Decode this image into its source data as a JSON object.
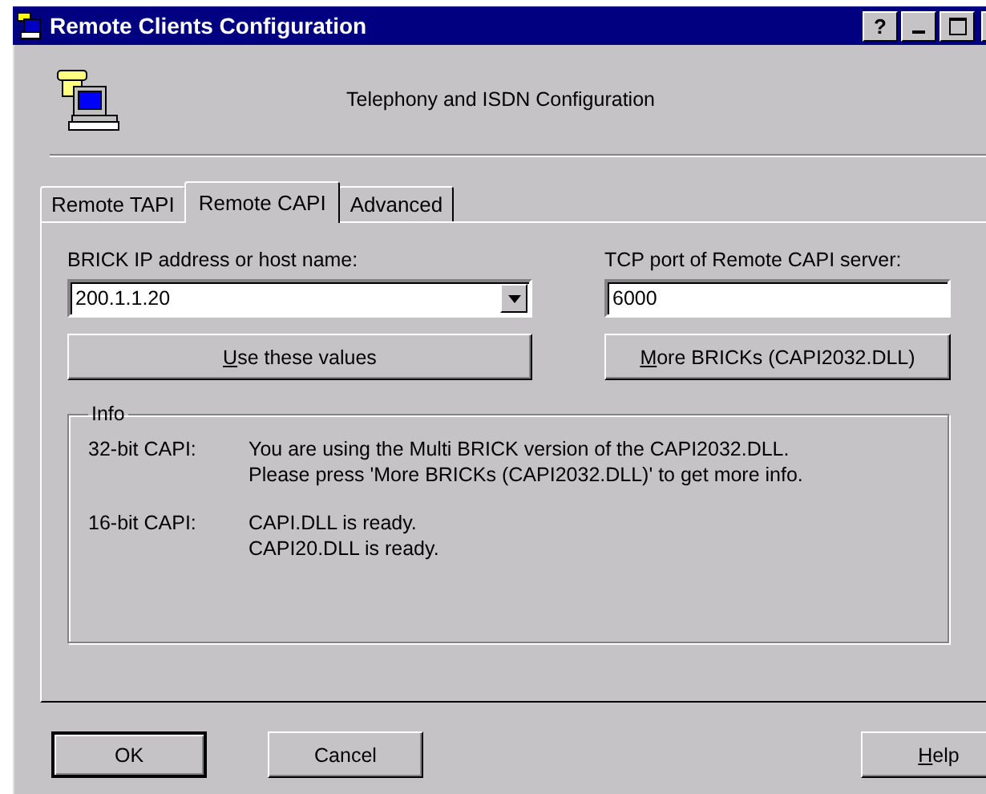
{
  "window": {
    "title": "Remote Clients Configuration",
    "title_buttons": [
      "?"
    ]
  },
  "header": {
    "text": "Telephony and ISDN Configuration"
  },
  "tabs": [
    {
      "label": "Remote TAPI",
      "selected": false
    },
    {
      "label": "Remote CAPI",
      "selected": true
    },
    {
      "label": "Advanced",
      "selected": false
    }
  ],
  "host": {
    "label": "BRICK IP address or host name:",
    "value": "200.1.1.20"
  },
  "port": {
    "label": "TCP port of Remote CAPI server:",
    "value": "6000"
  },
  "panel_buttons": [
    {
      "label": "Use these values",
      "underline_first": true
    },
    {
      "label": "More BRICKs (CAPI2032.DLL)",
      "underline_first": true
    }
  ],
  "info": {
    "title": "Info",
    "rows": [
      {
        "name": "32-bit CAPI:",
        "lines": [
          "You are using the Multi BRICK version of the CAPI2032.DLL.",
          "Please press 'More BRICKs (CAPI2032.DLL)' to get more info."
        ]
      },
      {
        "name": "16-bit CAPI:",
        "lines": [
          "CAPI.DLL is ready.",
          "CAPI20.DLL is ready."
        ]
      }
    ]
  },
  "buttons": [
    {
      "label": "OK",
      "default": true,
      "underline_first": false
    },
    {
      "label": "Cancel",
      "default": false,
      "underline_first": false
    },
    {
      "label": "Help",
      "default": false,
      "underline_first": true
    }
  ]
}
